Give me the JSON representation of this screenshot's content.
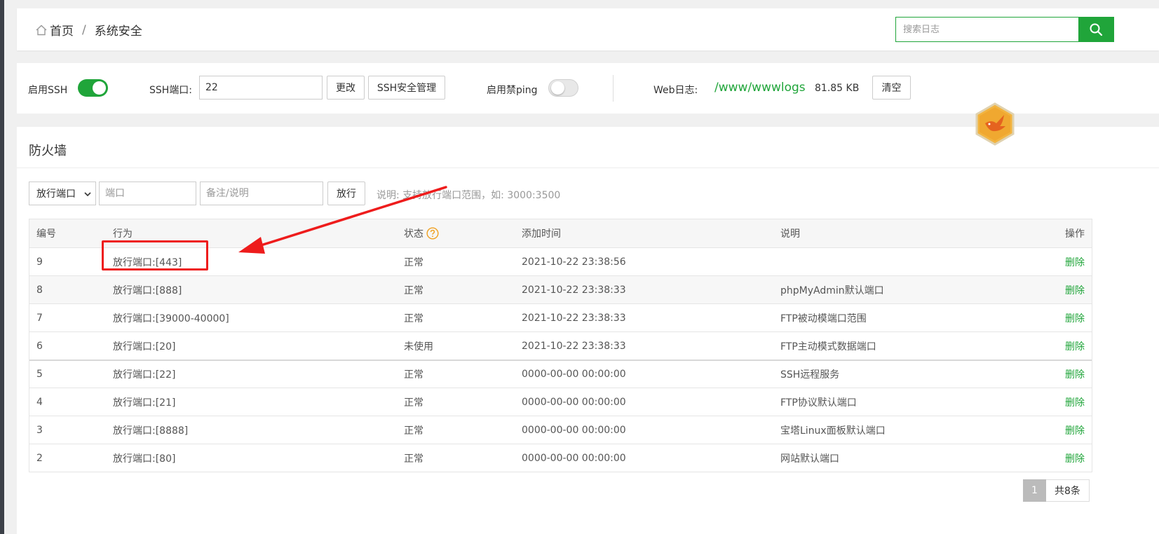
{
  "breadcrumb": {
    "home": "首页",
    "separator": "/",
    "current": "系统安全"
  },
  "search": {
    "placeholder": "搜索日志"
  },
  "settings": {
    "ssh_label": "启用SSH",
    "ssh_enabled": true,
    "ssh_port_label": "SSH端口:",
    "ssh_port_value": "22",
    "change_button": "更改",
    "ssh_manage_button": "SSH安全管理",
    "ping_label": "启用禁ping",
    "ping_enabled": false,
    "web_log_label": "Web日志:",
    "web_log_path": "/www/wwwlogs",
    "web_log_size": "81.85 KB",
    "clear_button": "清空"
  },
  "firewall": {
    "title": "防火墙",
    "type_select": "放行端口",
    "port_placeholder": "端口",
    "remark_placeholder": "备注/说明",
    "allow_button": "放行",
    "hint": "说明: 支持放行端口范围，如: 3000:3500",
    "columns": {
      "id": "编号",
      "action": "行为",
      "status": "状态",
      "time": "添加时间",
      "desc": "说明",
      "op": "操作"
    },
    "rows": [
      {
        "id": "9",
        "action": "放行端口:[443]",
        "status": "正常",
        "time": "2021-10-22 23:38:56",
        "desc": "",
        "op": "删除"
      },
      {
        "id": "8",
        "action": "放行端口:[888]",
        "status": "正常",
        "time": "2021-10-22 23:38:33",
        "desc": "phpMyAdmin默认端口",
        "op": "删除"
      },
      {
        "id": "7",
        "action": "放行端口:[39000-40000]",
        "status": "正常",
        "time": "2021-10-22 23:38:33",
        "desc": "FTP被动模端口范围",
        "op": "删除"
      },
      {
        "id": "6",
        "action": "放行端口:[20]",
        "status": "未使用",
        "time": "2021-10-22 23:38:33",
        "desc": "FTP主动模式数据端口",
        "op": "删除"
      },
      {
        "id": "5",
        "action": "放行端口:[22]",
        "status": "正常",
        "time": "0000-00-00 00:00:00",
        "desc": "SSH远程服务",
        "op": "删除"
      },
      {
        "id": "4",
        "action": "放行端口:[21]",
        "status": "正常",
        "time": "0000-00-00 00:00:00",
        "desc": "FTP协议默认端口",
        "op": "删除"
      },
      {
        "id": "3",
        "action": "放行端口:[8888]",
        "status": "正常",
        "time": "0000-00-00 00:00:00",
        "desc": "宝塔Linux面板默认端口",
        "op": "删除"
      },
      {
        "id": "2",
        "action": "放行端口:[80]",
        "status": "正常",
        "time": "0000-00-00 00:00:00",
        "desc": "网站默认端口",
        "op": "删除"
      }
    ],
    "pagination": {
      "current": "1",
      "total": "共8条"
    }
  },
  "colors": {
    "accent": "#20a53a",
    "annotation": "#ee1c1c"
  },
  "icons": {
    "home": "home-icon",
    "search": "search-icon",
    "help": "question-circle-icon",
    "badge": "bird-badge-icon"
  }
}
